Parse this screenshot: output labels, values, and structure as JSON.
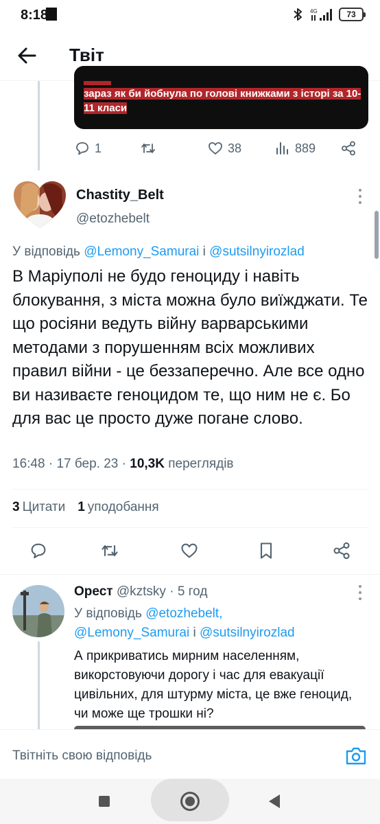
{
  "status_bar": {
    "time": "8:18",
    "network": "4G",
    "battery": "73"
  },
  "header": {
    "title": "Твіт"
  },
  "previous_tweet": {
    "media_caption": "зараз як би йобнула по голові книжками з історі за 10-11 класи",
    "replies": "1",
    "retweets": "",
    "likes": "38",
    "views": "889"
  },
  "main_tweet": {
    "author_name": "Chastity_Belt",
    "author_handle": "@etozhebelt",
    "reply_prefix": "У відповідь ",
    "reply_mention_1": "@Lemony_Samurai",
    "reply_joiner": " і ",
    "reply_mention_2": "@sutsilnyirozlad",
    "text": "В Маріуполі не будо геноциду і навіть блокування, з міста можна було виїжджати. Те що росіяни ведуть війну варварськими методами з порушенням всіх можливих правил війни - це беззаперечно. Але все одно ви називаєте геноцидом те, що ним не є. Бо для вас це просто дуже погане слово.",
    "time": "16:48",
    "date": "17 бер. 23",
    "views_count": "10,3K",
    "views_label": "переглядів",
    "quotes_count": "3",
    "quotes_label": "Цитати",
    "likes_count": "1",
    "likes_label": "уподобання"
  },
  "reply_tweet": {
    "author_name": "Орест",
    "author_handle": "@kztsky",
    "time_ago": "5 год",
    "reply_prefix": "У відповідь ",
    "reply_mention_1": "@etozhebelt,",
    "reply_mention_2": "@Lemony_Samurai",
    "reply_joiner": " і ",
    "reply_mention_3": "@sutsilnyirozlad",
    "text": "А прикриватись мирним населенням, викорстовуючи дорогу і час для евакуації цивільних, для штурму міста, це вже геноцид, чи може ще трошки ні?"
  },
  "compose": {
    "placeholder": "Твітніть свою відповідь"
  },
  "colors": {
    "accent": "#1d9bf0",
    "text_primary": "#0f1419",
    "text_secondary": "#536471"
  }
}
